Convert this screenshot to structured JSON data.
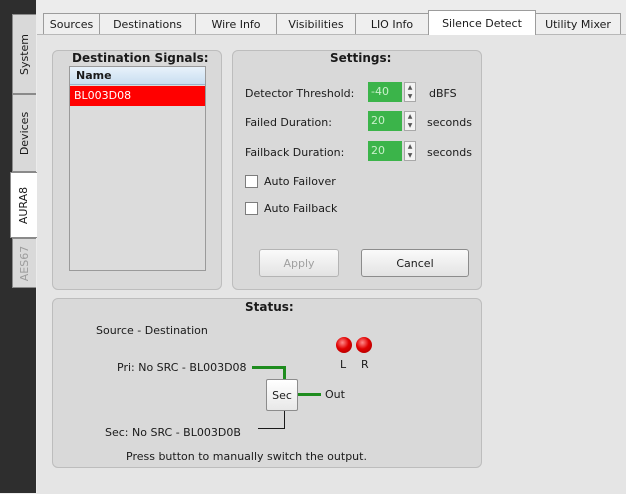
{
  "side_tabs": [
    {
      "label": "System"
    },
    {
      "label": "Devices"
    },
    {
      "label": "AURA8"
    },
    {
      "label": "AES67"
    }
  ],
  "top_tabs": [
    {
      "label": "Sources"
    },
    {
      "label": "Destinations"
    },
    {
      "label": "Wire Info"
    },
    {
      "label": "Visibilities"
    },
    {
      "label": "LIO Info"
    },
    {
      "label": "Silence Detect"
    },
    {
      "label": "Utility Mixer"
    }
  ],
  "destination_signals": {
    "title": "Destination Signals:",
    "column_header": "Name",
    "rows": [
      "BL003D08"
    ]
  },
  "settings": {
    "title": "Settings:",
    "detector_threshold": {
      "label": "Detector Threshold:",
      "value": "-40",
      "unit": "dBFS"
    },
    "failed_duration": {
      "label": "Failed Duration:",
      "value": "20",
      "unit": "seconds"
    },
    "failback_duration": {
      "label": "Failback Duration:",
      "value": "20",
      "unit": "seconds"
    },
    "auto_failover": {
      "label": "Auto Failover",
      "checked": false
    },
    "auto_failback": {
      "label": "Auto Failback",
      "checked": false
    },
    "apply_label": "Apply",
    "cancel_label": "Cancel"
  },
  "status": {
    "title": "Status:",
    "source_destination": "Source - Destination",
    "pri": "Pri: No SRC - BL003D08",
    "sec": "Sec: No SRC - BL003D0B",
    "sec_button": "Sec",
    "out": "Out",
    "led_left": "L",
    "led_right": "R",
    "hint": "Press button to manually switch the output."
  },
  "colors": {
    "selected_row": "#ff0000",
    "spinner_value": "#3bb44a",
    "led": "#e00000",
    "connector": "#1e8c1e"
  }
}
